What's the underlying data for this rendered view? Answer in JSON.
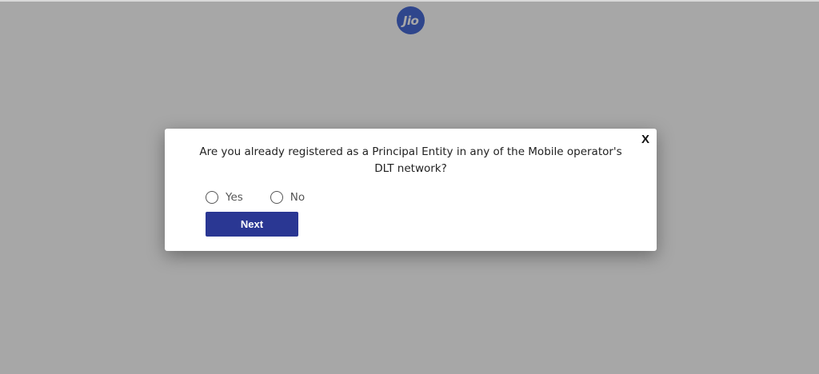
{
  "header": {
    "logo_text": "Jio",
    "logo_color": "#0f3cc9"
  },
  "modal": {
    "close_label": "X",
    "question": "Are you already registered as a Principal Entity in any of the Mobile operator's DLT network?",
    "options": [
      {
        "label": "Yes",
        "selected": false
      },
      {
        "label": "No",
        "selected": false
      }
    ],
    "next_label": "Next",
    "next_color": "#2a3793"
  }
}
